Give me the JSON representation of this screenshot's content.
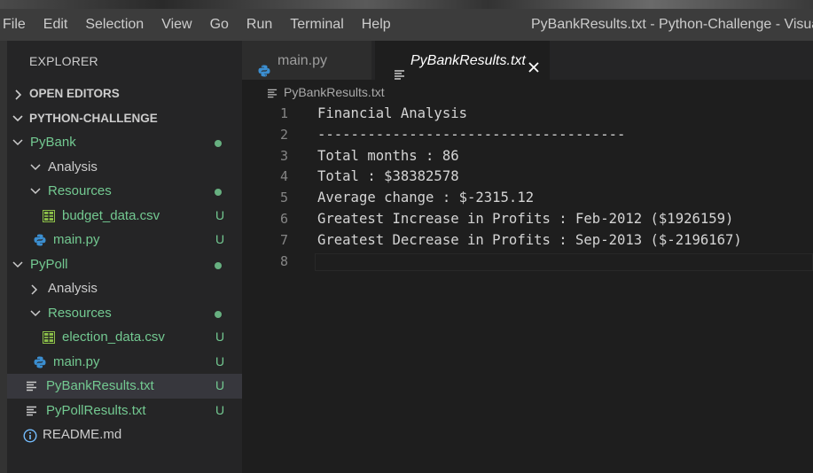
{
  "menu": [
    "File",
    "Edit",
    "Selection",
    "View",
    "Go",
    "Run",
    "Terminal",
    "Help"
  ],
  "window_title": "PyBankResults.txt - Python-Challenge - Visual St",
  "sidebar": {
    "title": "EXPLORER",
    "open_editors": "OPEN EDITORS",
    "root": "PYTHON-CHALLENGE",
    "tree": [
      {
        "label": "PyBank",
        "kind": "folder",
        "indent": 1,
        "expanded": true,
        "status": "dot",
        "green": true
      },
      {
        "label": "Analysis",
        "kind": "folder",
        "indent": 2,
        "expanded": true,
        "status": "",
        "green": false
      },
      {
        "label": "Resources",
        "kind": "folder",
        "indent": 2,
        "expanded": true,
        "status": "dot",
        "green": true
      },
      {
        "label": "budget_data.csv",
        "kind": "csv",
        "indent": 3,
        "status": "U",
        "green": true
      },
      {
        "label": "main.py",
        "kind": "py",
        "indent": 2,
        "status": "U",
        "green": true
      },
      {
        "label": "PyPoll",
        "kind": "folder",
        "indent": 1,
        "expanded": true,
        "status": "dot",
        "green": true
      },
      {
        "label": "Analysis",
        "kind": "folder",
        "indent": 2,
        "expanded": false,
        "status": "",
        "green": false
      },
      {
        "label": "Resources",
        "kind": "folder",
        "indent": 2,
        "expanded": true,
        "status": "dot",
        "green": true
      },
      {
        "label": "election_data.csv",
        "kind": "csv",
        "indent": 3,
        "status": "U",
        "green": true
      },
      {
        "label": "main.py",
        "kind": "py",
        "indent": 2,
        "status": "U",
        "green": true
      },
      {
        "label": "PyBankResults.txt",
        "kind": "txt",
        "indent": 1,
        "status": "U",
        "green": true,
        "selected": true
      },
      {
        "label": "PyPollResults.txt",
        "kind": "txt",
        "indent": 1,
        "status": "U",
        "green": true
      },
      {
        "label": "README.md",
        "kind": "info",
        "indent": 1,
        "status": "",
        "green": false
      }
    ]
  },
  "tabs": [
    {
      "label": "main.py",
      "icon": "python-icon",
      "active": false
    },
    {
      "label": "PyBankResults.txt",
      "icon": "text-file-icon",
      "active": true,
      "close": "close-icon"
    }
  ],
  "breadcrumb": "PyBankResults.txt",
  "editor": {
    "lines": [
      "Financial Analysis",
      "-------------------------------------",
      "Total months : 86",
      "Total : $38382578",
      "Average change : $-2315.12",
      "Greatest Increase in Profits : Feb-2012 ($1926159)",
      "Greatest Decrease in Profits : Sep-2013 ($-2196167)",
      ""
    ]
  },
  "colors": {
    "accent_green": "#73c991",
    "python_blue": "#3b8ed0",
    "csv_green": "#8dc149",
    "info_blue": "#75beff"
  }
}
